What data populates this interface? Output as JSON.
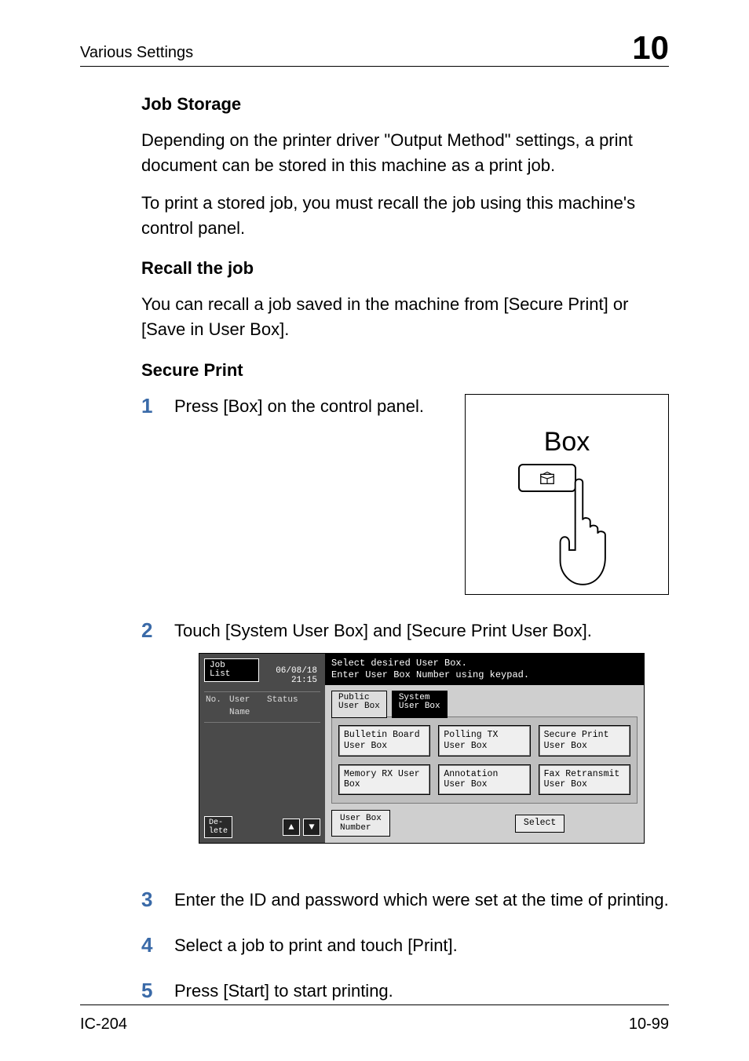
{
  "header": {
    "section": "Various Settings",
    "chapter": "10"
  },
  "footer": {
    "left": "IC-204",
    "right": "10-99"
  },
  "s1": {
    "title": "Job Storage",
    "p1": "Depending on the printer driver \"Output Method\" settings, a print document can be stored in this machine as a print job.",
    "p2": "To print a stored job, you must recall the job using this machine's control panel."
  },
  "s2": {
    "title": "Recall the job",
    "p1": "You can recall a job saved in the machine from [Secure Print] or [Save in User Box]."
  },
  "s3": {
    "title": "Secure Print",
    "steps": {
      "1": "Press [Box] on the control panel.",
      "2": "Touch [System User Box] and [Secure Print User Box].",
      "3": "Enter the ID and password which were set at the time of printing.",
      "4": "Select a job to print and touch [Print].",
      "5": "Press [Start] to start printing."
    }
  },
  "boxfig": {
    "label": "Box"
  },
  "panel": {
    "job_tab": "Job\nList",
    "date": "06/08/18",
    "time": "21:15",
    "cols": {
      "no": "No.",
      "user": "User\nName",
      "status": "Status"
    },
    "delete": "De-\nlete",
    "msg1": "Select desired User Box.",
    "msg2": "Enter User Box Number using keypad.",
    "tab_public": "Public\nUser Box",
    "tab_system": "System\nUser Box",
    "opts": [
      "Bulletin Board User Box",
      "Polling TX User Box",
      "Secure Print User Box",
      "Memory RX User Box",
      "Annotation User Box",
      "Fax Retransmit User Box"
    ],
    "userboxnum": "User Box\nNumber",
    "select": "Select"
  }
}
